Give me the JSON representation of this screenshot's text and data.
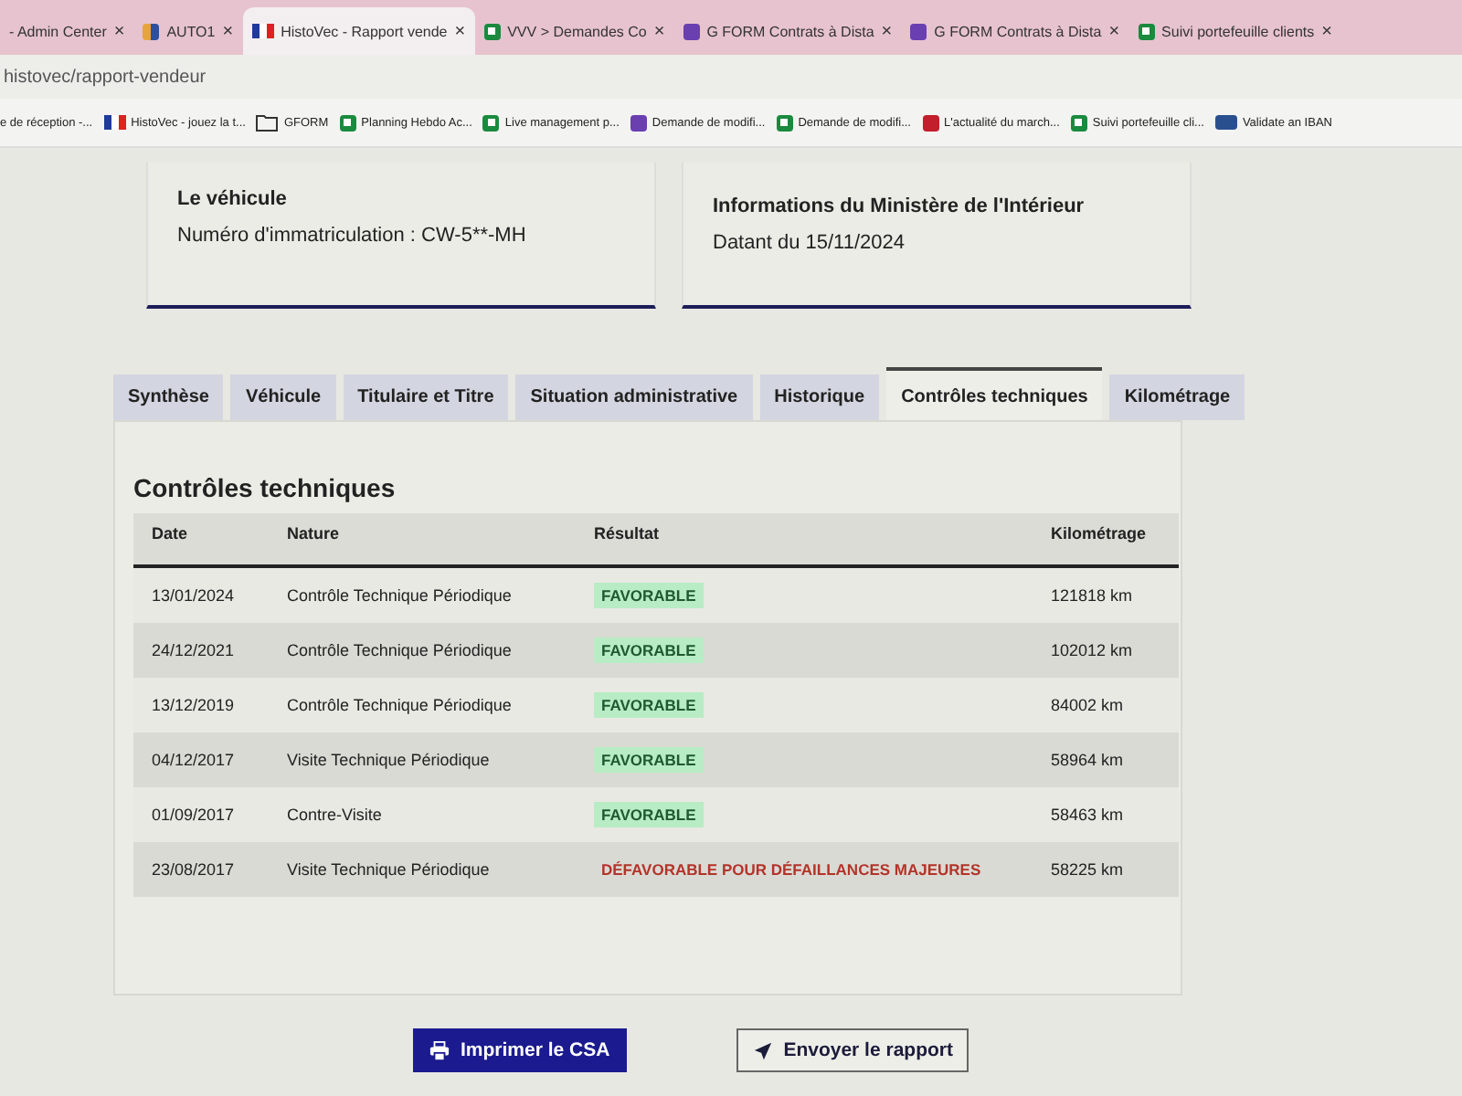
{
  "browser": {
    "tabs": [
      {
        "title": "- Admin Center",
        "kind": "none",
        "selected": false
      },
      {
        "title": "AUTO1",
        "kind": "auto1",
        "selected": false
      },
      {
        "title": "HistoVec - Rapport vende",
        "kind": "flag",
        "selected": true
      },
      {
        "title": "VVV > Demandes Co",
        "kind": "sheets",
        "selected": false
      },
      {
        "title": "G FORM Contrats à Dista",
        "kind": "forms",
        "selected": false
      },
      {
        "title": "G FORM Contrats à Dista",
        "kind": "forms",
        "selected": false
      },
      {
        "title": "Suivi portefeuille clients",
        "kind": "sheets",
        "selected": false
      }
    ],
    "close_glyph": "×",
    "url": "histovec/rapport-vendeur",
    "bookmarks": [
      {
        "label": "e de réception -...",
        "kind": "none"
      },
      {
        "label": "HistoVec - jouez la t...",
        "kind": "flag"
      },
      {
        "label": "GFORM",
        "kind": "folder"
      },
      {
        "label": "Planning Hebdo Ac...",
        "kind": "sheets"
      },
      {
        "label": "Live management p...",
        "kind": "sheets"
      },
      {
        "label": "Demande de modifi...",
        "kind": "forms"
      },
      {
        "label": "Demande de modifi...",
        "kind": "sheets"
      },
      {
        "label": "L'actualité du march...",
        "kind": "ai"
      },
      {
        "label": "Suivi portefeuille cli...",
        "kind": "sheets"
      },
      {
        "label": "Validate an IBAN",
        "kind": "bank"
      }
    ]
  },
  "cards": [
    {
      "title": "Le véhicule",
      "text": "Numéro d'immatriculation : CW-5**-MH"
    },
    {
      "title": "Informations du Ministère de l'Intérieur",
      "text": "Datant du 15/11/2024"
    }
  ],
  "tabs": [
    {
      "label": "Synthèse",
      "selected": false
    },
    {
      "label": "Véhicule",
      "selected": false
    },
    {
      "label": "Titulaire et Titre",
      "selected": false
    },
    {
      "label": "Situation administrative",
      "selected": false
    },
    {
      "label": "Historique",
      "selected": false
    },
    {
      "label": "Contrôles techniques",
      "selected": true
    },
    {
      "label": "Kilométrage",
      "selected": false
    }
  ],
  "section_title": "Contrôles techniques",
  "table": {
    "columns": [
      "Date",
      "Nature",
      "Résultat",
      "Kilométrage"
    ],
    "rows": [
      {
        "date": "13/01/2024",
        "nature": "Contrôle Technique Périodique",
        "result": "FAVORABLE",
        "kind": "favorable",
        "km": "121818 km"
      },
      {
        "date": "24/12/2021",
        "nature": "Contrôle Technique Périodique",
        "result": "FAVORABLE",
        "kind": "favorable",
        "km": "102012 km"
      },
      {
        "date": "13/12/2019",
        "nature": "Contrôle Technique Périodique",
        "result": "FAVORABLE",
        "kind": "favorable",
        "km": "84002 km"
      },
      {
        "date": "04/12/2017",
        "nature": "Visite Technique Périodique",
        "result": "FAVORABLE",
        "kind": "favorable",
        "km": "58964 km"
      },
      {
        "date": "01/09/2017",
        "nature": "Contre-Visite",
        "result": "FAVORABLE",
        "kind": "favorable",
        "km": "58463 km"
      },
      {
        "date": "23/08/2017",
        "nature": "Visite Technique Périodique",
        "result": "DÉFAVORABLE POUR DÉFAILLANCES MAJEURES",
        "kind": "defavorable",
        "km": "58225 km"
      }
    ]
  },
  "buttons": [
    {
      "label": "Imprimer le CSA",
      "kind": "primary"
    },
    {
      "label": "Envoyer le rapport",
      "kind": "secondary"
    }
  ]
}
